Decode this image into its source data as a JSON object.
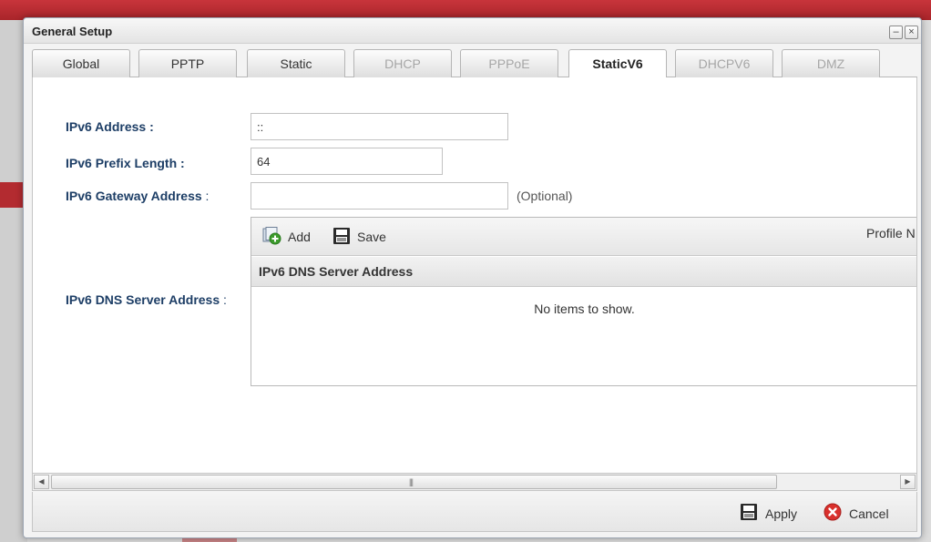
{
  "dialog": {
    "title": "General Setup",
    "minimize_symbol": "–",
    "close_symbol": "×"
  },
  "tabs": [
    {
      "label": "Global",
      "state": "enabled"
    },
    {
      "label": "PPTP",
      "state": "enabled"
    },
    {
      "label": "Static",
      "state": "enabled"
    },
    {
      "label": "DHCP",
      "state": "disabled"
    },
    {
      "label": "PPPoE",
      "state": "disabled"
    },
    {
      "label": "StaticV6",
      "state": "active"
    },
    {
      "label": "DHCPV6",
      "state": "disabled"
    },
    {
      "label": "DMZ",
      "state": "disabled"
    }
  ],
  "form": {
    "ipv6_address_label": "IPv6 Address :",
    "ipv6_address_value": "::",
    "prefix_length_label": "IPv6 Prefix Length :",
    "prefix_length_value": "64",
    "gateway_label": "IPv6 Gateway Address",
    "gateway_colon": " :",
    "gateway_value": "",
    "optional_text": "(Optional)",
    "dns_label": "IPv6 DNS Server Address",
    "dns_colon": " :"
  },
  "dns_grid": {
    "add_label": "Add",
    "save_label": "Save",
    "profile_label": "Profile N",
    "column_header": "IPv6 DNS Server Address",
    "empty_text": "No items to show."
  },
  "footer": {
    "apply_label": "Apply",
    "cancel_label": "Cancel"
  },
  "colors": {
    "label_blue": "#1d3e66",
    "brand_red": "#b32b30",
    "cancel_red": "#d9302c",
    "add_green": "#3c9b2c"
  }
}
